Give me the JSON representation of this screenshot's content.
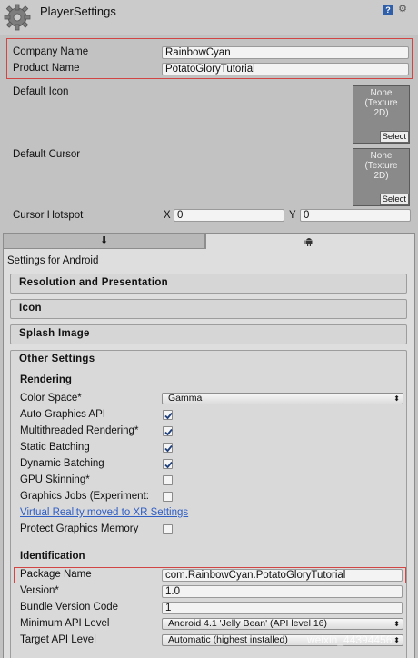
{
  "header": {
    "title": "PlayerSettings"
  },
  "top": {
    "company_label": "Company Name",
    "company_value": "RainbowCyan",
    "product_label": "Product Name",
    "product_value": "PotatoGloryTutorial",
    "default_icon_label": "Default Icon",
    "default_cursor_label": "Default Cursor",
    "texture_none": "None",
    "texture_type_1": "(Texture",
    "texture_type_2": "2D)",
    "select_label": "Select",
    "cursor_hotspot_label": "Cursor Hotspot",
    "x_label": "X",
    "x_value": "0",
    "y_label": "Y",
    "y_value": "0"
  },
  "platform": {
    "settings_for": "Settings for Android"
  },
  "sections": {
    "resolution": "Resolution and Presentation",
    "icon": "Icon",
    "splash": "Splash Image",
    "other": "Other Settings"
  },
  "rendering": {
    "heading": "Rendering",
    "color_space_label": "Color Space*",
    "color_space_value": "Gamma",
    "auto_graphics": "Auto Graphics API",
    "multithreaded": "Multithreaded Rendering*",
    "static_batching": "Static Batching",
    "dynamic_batching": "Dynamic Batching",
    "gpu_skinning": "GPU Skinning*",
    "graphics_jobs": "Graphics Jobs (Experiment:",
    "vr_link": "Virtual Reality moved to XR Settings",
    "protect_graphics": "Protect Graphics Memory"
  },
  "identification": {
    "heading": "Identification",
    "package_label": "Package Name",
    "package_value": "com.RainbowCyan.PotatoGloryTutorial",
    "version_label": "Version*",
    "version_value": "1.0",
    "bundle_label": "Bundle Version Code",
    "bundle_value": "1",
    "min_api_label": "Minimum API Level",
    "min_api_value": "Android 4.1 'Jelly Bean' (API level 16)",
    "target_api_label": "Target API Level",
    "target_api_value": "Automatic (highest installed)"
  },
  "watermark": "weixin_44394456",
  "colors": {
    "highlight": "#d24545",
    "link": "#2f5ec4",
    "checkmark": "#1f3f7a"
  }
}
